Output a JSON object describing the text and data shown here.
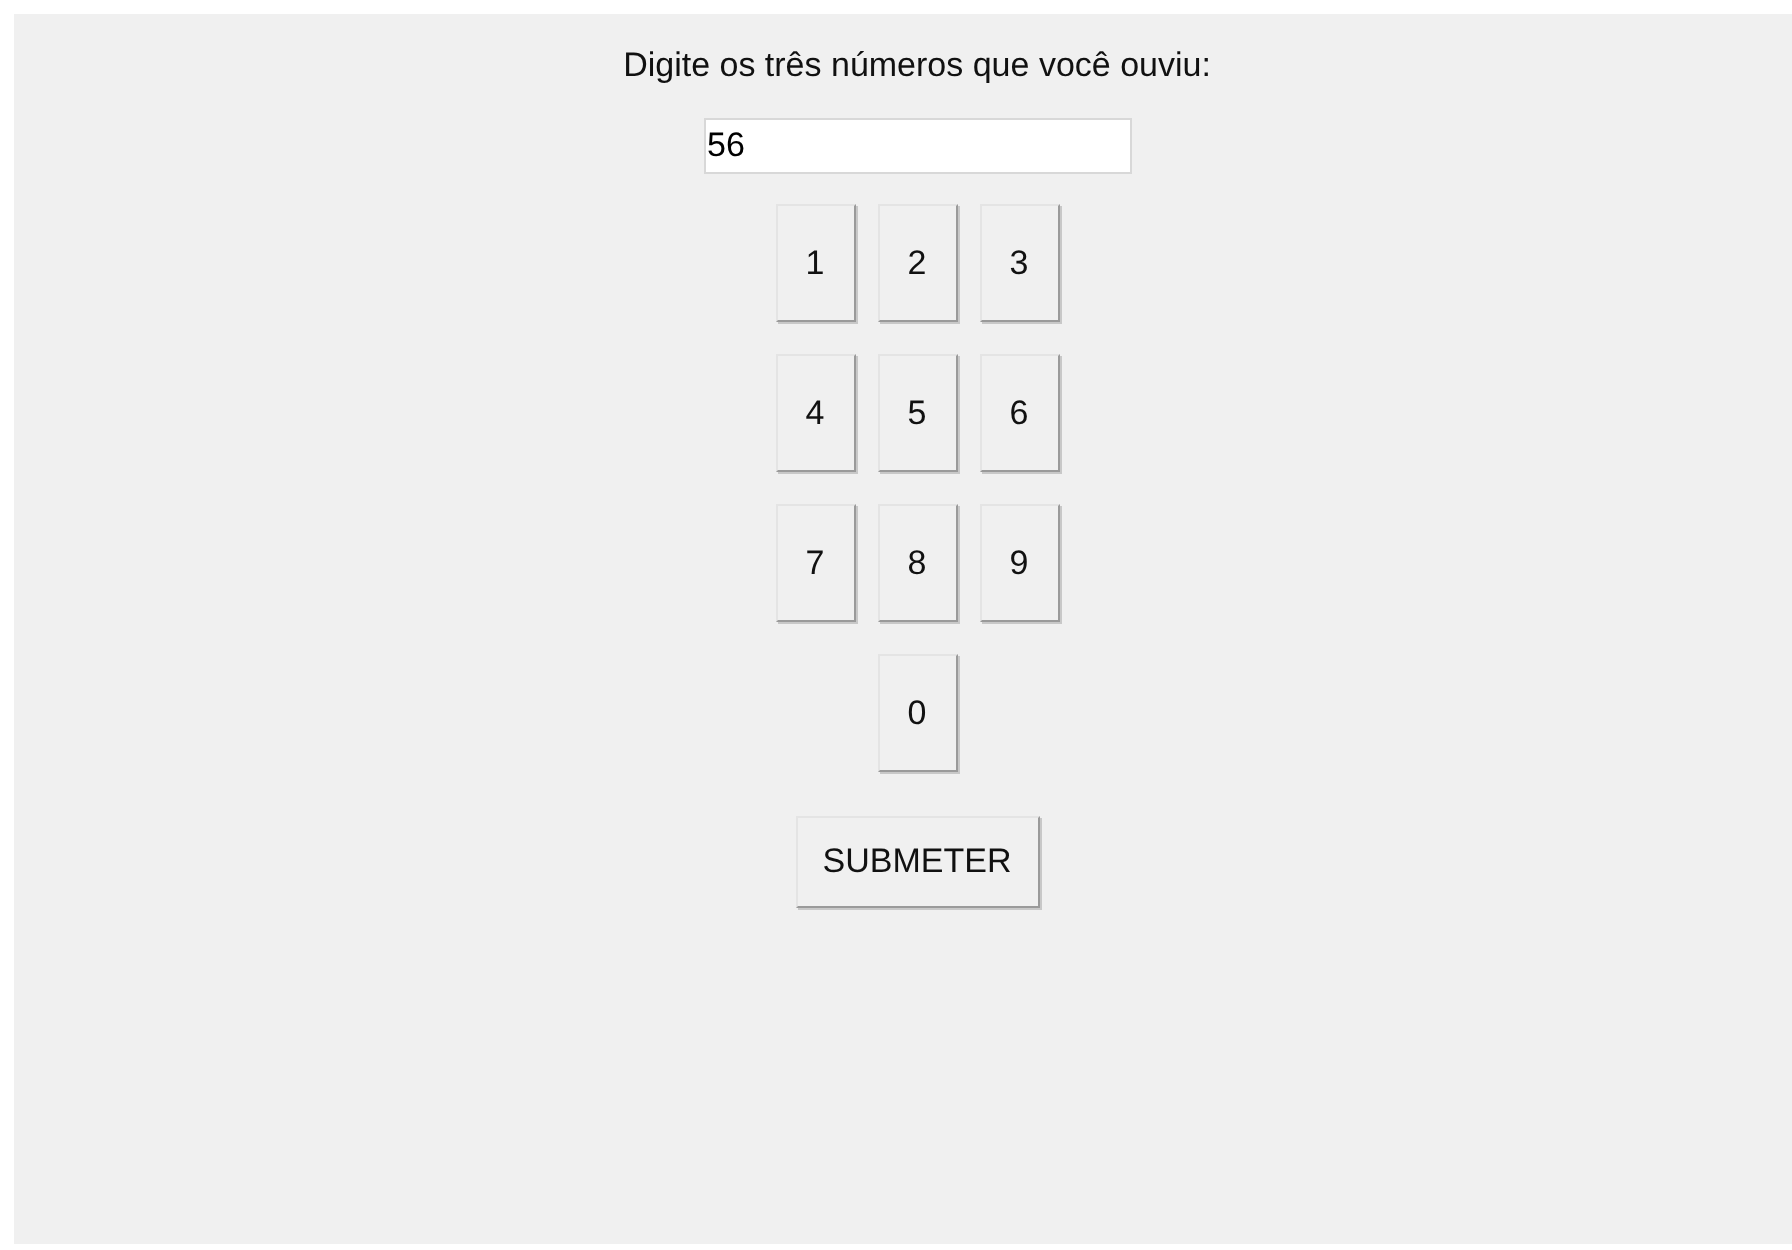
{
  "prompt": "Digite os três números que você ouviu:",
  "answer": {
    "value": "56"
  },
  "keypad": [
    {
      "label": "1"
    },
    {
      "label": "2"
    },
    {
      "label": "3"
    },
    {
      "label": "4"
    },
    {
      "label": "5"
    },
    {
      "label": "6"
    },
    {
      "label": "7"
    },
    {
      "label": "8"
    },
    {
      "label": "9"
    },
    {
      "label": "0"
    }
  ],
  "submit": {
    "label": "SUBMETER"
  }
}
